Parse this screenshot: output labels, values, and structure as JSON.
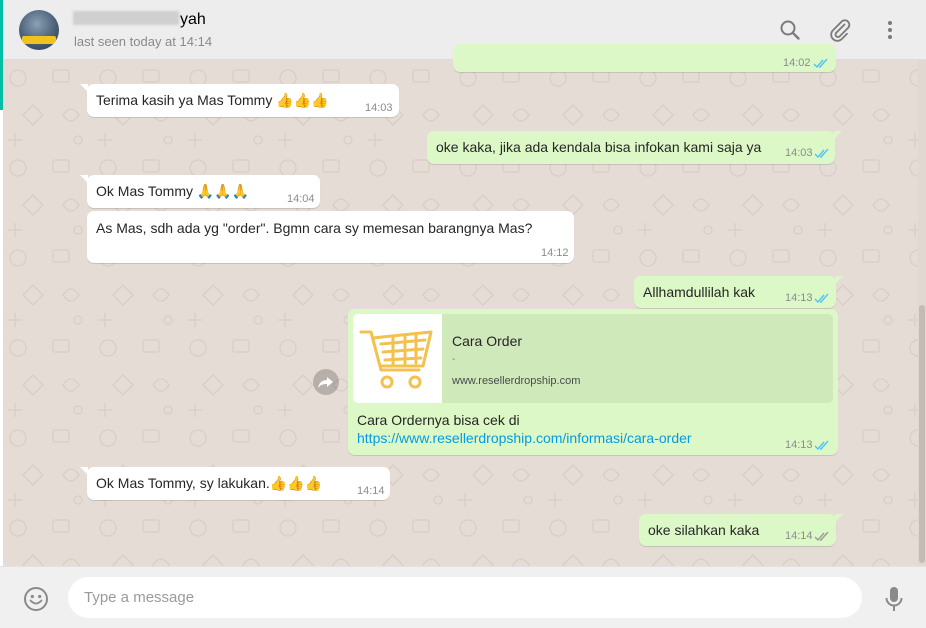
{
  "header": {
    "contact_name_suffix": "yah",
    "status": "last seen today at 14:14",
    "icons": [
      "search-icon",
      "attach-icon",
      "menu-icon"
    ]
  },
  "messages": [
    {
      "id": "partial",
      "direction": "out",
      "text": "",
      "time": "14:02",
      "ticks": "read"
    },
    {
      "id": "m1",
      "direction": "in",
      "text": "Terima kasih ya Mas Tommy",
      "emoji": "👍👍👍",
      "time": "14:03"
    },
    {
      "id": "m2",
      "direction": "out",
      "text": "oke kaka, jika ada kendala bisa infokan kami saja ya",
      "time": "14:03",
      "ticks": "read"
    },
    {
      "id": "m3",
      "direction": "in",
      "text": "Ok Mas Tommy",
      "emoji": "🙏🙏🙏",
      "time": "14:04"
    },
    {
      "id": "m4",
      "direction": "in",
      "text": "As Mas, sdh ada yg \"order\". Bgmn cara sy memesan barangnya Mas?",
      "time": "14:12"
    },
    {
      "id": "m5",
      "direction": "out",
      "text": "Allhamdullilah kak",
      "time": "14:13",
      "ticks": "read"
    },
    {
      "id": "m6",
      "direction": "out",
      "preview": {
        "title": "Cara Order",
        "dash": "-",
        "site": "www.resellerdropship.com"
      },
      "text": "Cara Ordernya bisa cek di",
      "link": "https://www.resellerdropship.com/informasi/cara-order",
      "time": "14:13",
      "ticks": "read"
    },
    {
      "id": "m7",
      "direction": "in",
      "text": "Ok Mas Tommy, sy lakukan.",
      "emoji": "👍👍👍",
      "time": "14:14"
    },
    {
      "id": "m8",
      "direction": "out",
      "text": "oke silahkan kaka",
      "time": "14:14",
      "ticks": "delivered"
    }
  ],
  "footer": {
    "placeholder": "Type a message",
    "icons": [
      "emoji-icon",
      "microphone-icon"
    ]
  },
  "colors": {
    "incoming": "#ffffff",
    "outgoing": "#dcf8c6",
    "background": "#e5ddd5",
    "read_tick": "#4fc3f7",
    "header": "#ededed"
  }
}
